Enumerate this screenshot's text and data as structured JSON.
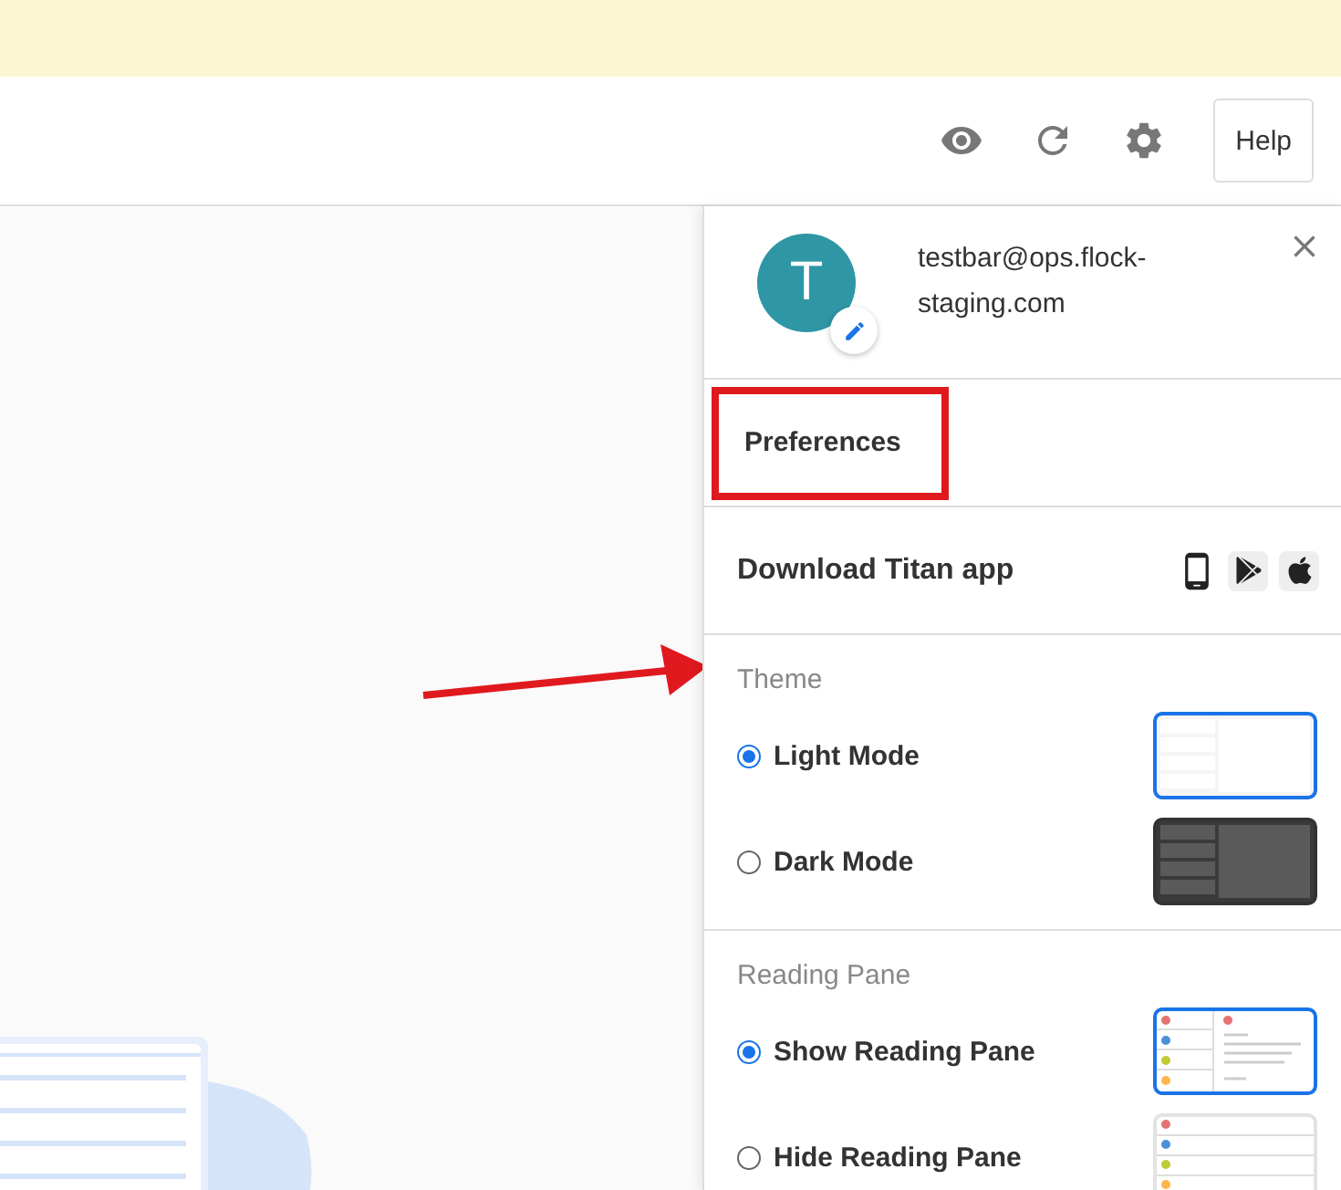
{
  "toolbar": {
    "help_button": "Help"
  },
  "profile_panel": {
    "avatar_initial": "T",
    "email": "testbar@ops.flock-staging.com",
    "preferences": {
      "label": "Preferences",
      "highlighted": true
    },
    "download": {
      "label": "Download Titan app"
    },
    "sections": [
      {
        "title": "Theme",
        "options": [
          {
            "label": "Light Mode",
            "selected": true,
            "kind": "light"
          },
          {
            "label": "Dark Mode",
            "selected": false,
            "kind": "dark"
          }
        ]
      },
      {
        "title": "Reading Pane",
        "options": [
          {
            "label": "Show Reading Pane",
            "selected": true,
            "kind": "show_pane"
          },
          {
            "label": "Hide Reading Pane",
            "selected": false,
            "kind": "hide_pane"
          }
        ]
      }
    ]
  }
}
